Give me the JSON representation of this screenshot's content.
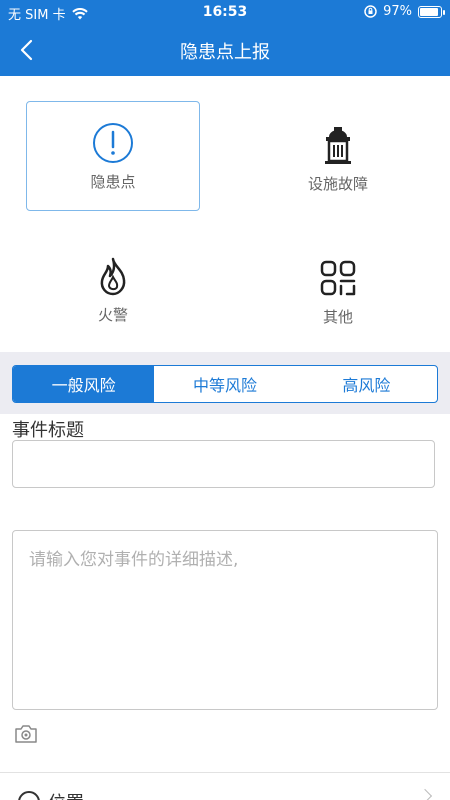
{
  "status_bar": {
    "carrier": "无 SIM 卡",
    "time": "16:53",
    "battery_percent": "97%",
    "battery_level": 0.97
  },
  "nav": {
    "title": "隐患点上报"
  },
  "categories": [
    {
      "label": "隐患点",
      "icon": "alert-circle-icon",
      "selected": true
    },
    {
      "label": "设施故障",
      "icon": "fire-hydrant-icon",
      "selected": false
    },
    {
      "label": "火警",
      "icon": "flame-icon",
      "selected": false
    },
    {
      "label": "其他",
      "icon": "grid-icon",
      "selected": false
    }
  ],
  "risk_tabs": [
    {
      "label": "一般风险",
      "active": true
    },
    {
      "label": "中等风险",
      "active": false
    },
    {
      "label": "高风险",
      "active": false
    }
  ],
  "form": {
    "title_label": "事件标题",
    "title_value": "",
    "description_placeholder": "请输入您对事件的详细描述,"
  },
  "location": {
    "label": "位置"
  },
  "colors": {
    "primary": "#1c7ad6",
    "tab_strip_bg": "#ececf2",
    "selected_border": "#7fb8ea"
  }
}
